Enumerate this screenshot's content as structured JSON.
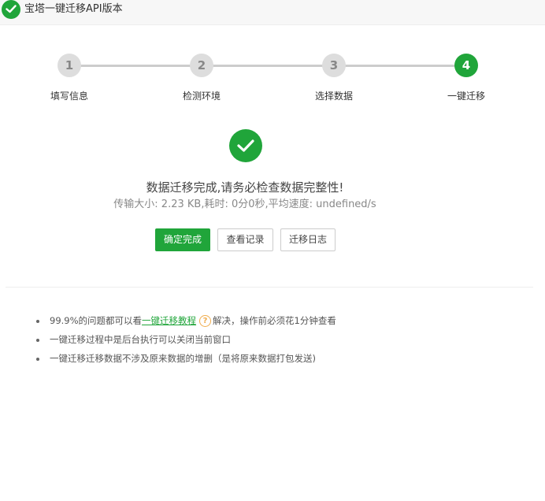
{
  "window": {
    "title": "宝塔一键迁移API版本"
  },
  "steps": [
    {
      "number": "1",
      "label": "填写信息"
    },
    {
      "number": "2",
      "label": "检测环境"
    },
    {
      "number": "3",
      "label": "选择数据"
    },
    {
      "number": "4",
      "label": "一键迁移"
    }
  ],
  "result": {
    "message": "数据迁移完成,请务必检查数据完整性!",
    "stats": "传输大小: 2.23 KB,耗时: 0分0秒,平均速度: undefined/s"
  },
  "buttons": {
    "confirm": "确定完成",
    "records": "查看记录",
    "log": "迁移日志"
  },
  "tips": {
    "tip1_prefix": "99.9%的问题都可以看",
    "tip1_link": "一键迁移教程",
    "tip1_help": "?",
    "tip1_suffix": "解决，操作前必须花1分钟查看",
    "tip2": "一键迁移过程中是后台执行可以关闭当前窗口",
    "tip3": "一键迁移迁移数据不涉及原来数据的增删（是将原来数据打包发送)"
  },
  "colors": {
    "accent": "#20a53a",
    "inactive_step": "#dddddd",
    "help_icon": "#f0ad4e"
  },
  "icons": {
    "title": "check-circle-icon",
    "success": "check-circle-icon",
    "help": "question-circle-icon"
  }
}
